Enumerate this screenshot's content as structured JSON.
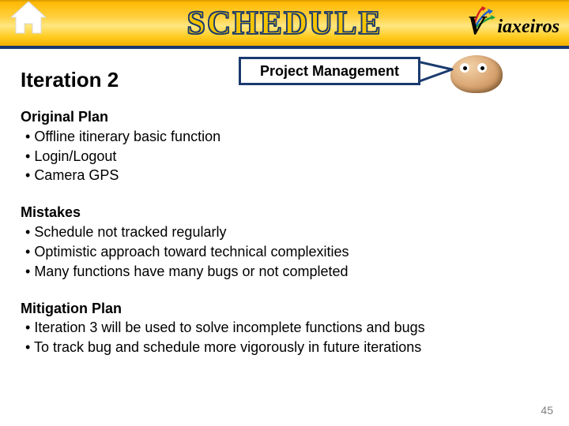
{
  "header": {
    "title": "SCHEDULE",
    "brand_rest": "iaxeiros"
  },
  "sub": {
    "iteration": "Iteration 2",
    "pm": "Project Management"
  },
  "sections": {
    "s1": {
      "title": "Original Plan",
      "b1": "Offline itinerary basic function",
      "b2": "Login/Logout",
      "b3": "Camera GPS"
    },
    "s2": {
      "title": "Mistakes",
      "b1": "Schedule not tracked regularly",
      "b2": "Optimistic approach toward technical complexities",
      "b3": "Many functions have many bugs or not completed"
    },
    "s3": {
      "title": "Mitigation Plan",
      "b1": "Iteration 3 will be used to solve incomplete functions and bugs",
      "b2": "To track bug and schedule more vigorously in future iterations"
    }
  },
  "page": "45"
}
